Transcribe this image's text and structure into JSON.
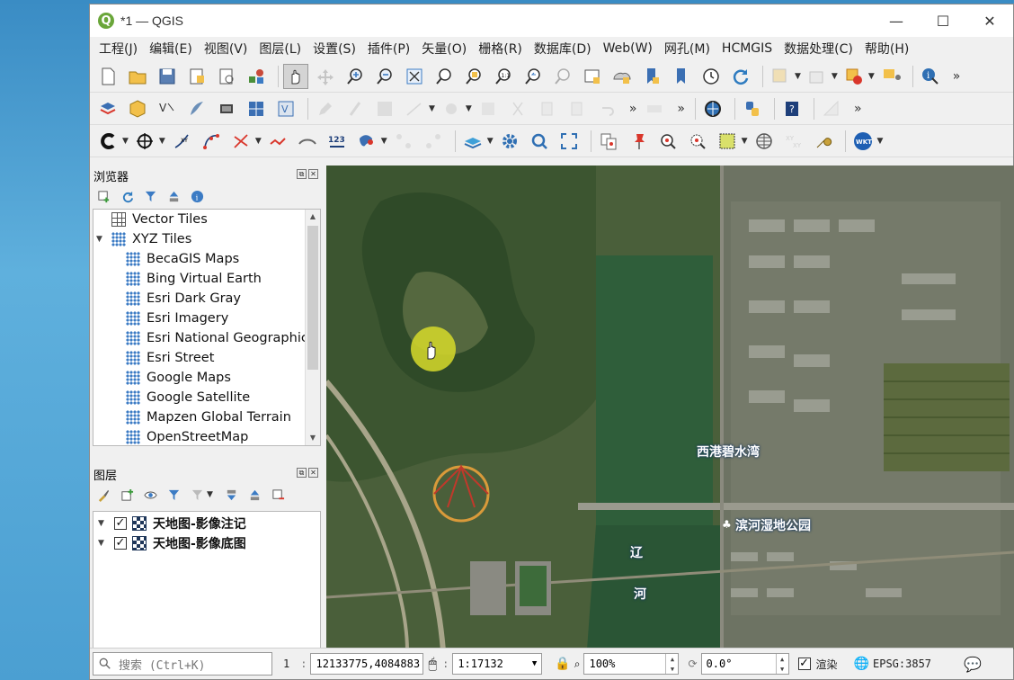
{
  "window": {
    "title": "*1 — QGIS",
    "logo": "Q",
    "controls": [
      "—",
      "☐",
      "✕"
    ]
  },
  "menu": [
    "工程(J)",
    "编辑(E)",
    "视图(V)",
    "图层(L)",
    "设置(S)",
    "插件(P)",
    "矢量(O)",
    "栅格(R)",
    "数据库(D)",
    "Web(W)",
    "网孔(M)",
    "HCMGIS",
    "数据处理(C)",
    "帮助(H)"
  ],
  "toolbar3": {
    "label_123": "123",
    "wkt_badge": "WKT"
  },
  "browser": {
    "title": "浏览器",
    "items": [
      {
        "label": "Vector Tiles",
        "level": 0,
        "icon": "grid-icon"
      },
      {
        "label": "XYZ Tiles",
        "level": 0,
        "icon": "xyz-icon",
        "expanded": true
      },
      {
        "label": "BecaGIS Maps",
        "level": 1,
        "icon": "xyz-icon"
      },
      {
        "label": "Bing Virtual Earth",
        "level": 1,
        "icon": "xyz-icon"
      },
      {
        "label": "Esri Dark Gray",
        "level": 1,
        "icon": "xyz-icon"
      },
      {
        "label": "Esri Imagery",
        "level": 1,
        "icon": "xyz-icon"
      },
      {
        "label": "Esri National Geographic",
        "level": 1,
        "icon": "xyz-icon"
      },
      {
        "label": "Esri Street",
        "level": 1,
        "icon": "xyz-icon"
      },
      {
        "label": "Google Maps",
        "level": 1,
        "icon": "xyz-icon"
      },
      {
        "label": "Google Satellite",
        "level": 1,
        "icon": "xyz-icon"
      },
      {
        "label": "Mapzen Global Terrain",
        "level": 1,
        "icon": "xyz-icon"
      },
      {
        "label": "OpenStreetMap",
        "level": 1,
        "icon": "xyz-icon"
      }
    ]
  },
  "layers": {
    "title": "图层",
    "items": [
      {
        "label": "天地图-影像注记",
        "checked": true
      },
      {
        "label": "天地图-影像底图",
        "checked": true
      }
    ]
  },
  "map": {
    "labels": {
      "district": "西港碧水湾",
      "park": "滨河湿地公园",
      "river_1": "辽",
      "river_2": "河"
    }
  },
  "status": {
    "search_placeholder": "搜索 (Ctrl+K)",
    "coord_label": "1",
    "coordinate": "12133775,4084883",
    "scale": "1:17132",
    "magnifier": "100%",
    "rotation": "0.0°",
    "render_label": "渲染",
    "crs": "EPSG:3857"
  },
  "colors": {
    "accent": "#3b7bc4",
    "map_bg": "#3f5734",
    "river": "#2f5e3a"
  }
}
